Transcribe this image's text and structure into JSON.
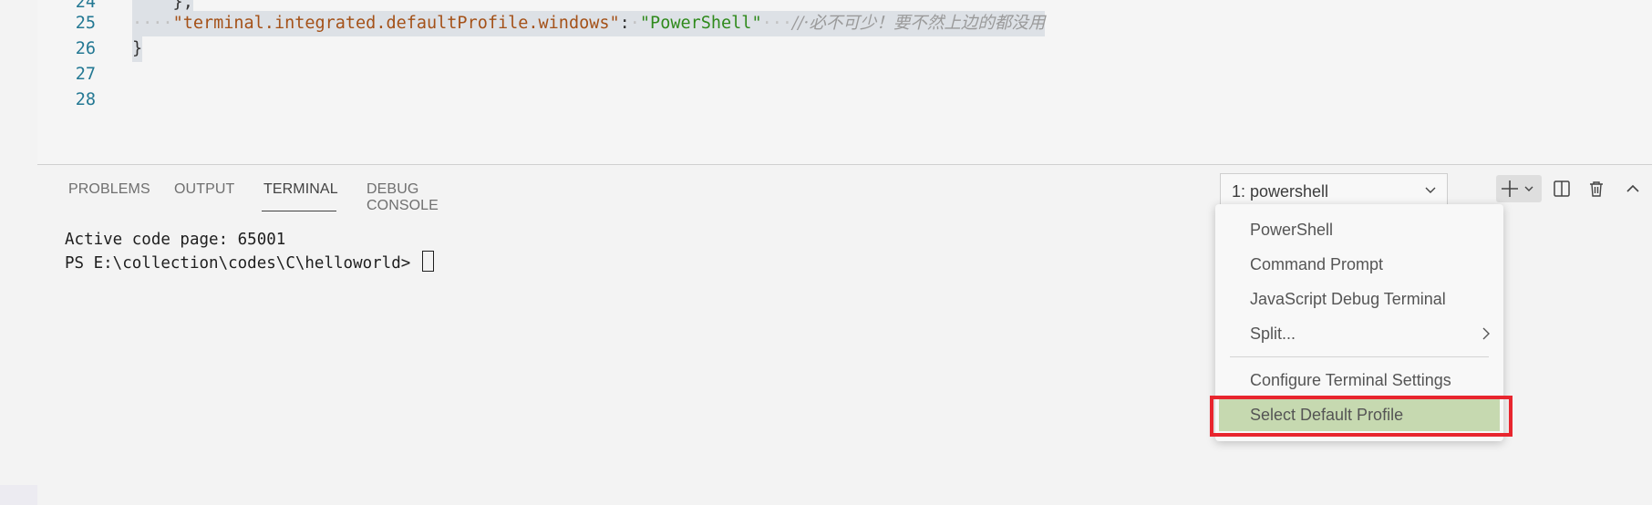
{
  "editor": {
    "lines": [
      {
        "num": "24",
        "text": "    },"
      },
      {
        "num": "25",
        "indent": "····",
        "key": "\"terminal.integrated.defaultProfile.windows\"",
        "colon": ":",
        "value": "\"PowerShell\"",
        "comment": "//·必不可少！要不然上边的都没用"
      },
      {
        "num": "26",
        "text": "}"
      },
      {
        "num": "27",
        "text": ""
      },
      {
        "num": "28",
        "text": ""
      }
    ]
  },
  "panel": {
    "tabs": [
      "PROBLEMS",
      "OUTPUT",
      "TERMINAL",
      "DEBUG CONSOLE"
    ],
    "active_tab": "TERMINAL",
    "terminal_lines": [
      "Active code page: 65001",
      "PS E:\\collection\\codes\\C\\helloworld> "
    ],
    "terminal_select": "1: powershell",
    "icons": {
      "new_terminal": "plus-icon",
      "launch_profile": "chevron-down-icon",
      "split": "split-icon",
      "kill": "trash-icon",
      "maximize": "chevron-up-icon",
      "close": "close-icon"
    }
  },
  "dropdown": {
    "items": [
      "PowerShell",
      "Command Prompt",
      "JavaScript Debug Terminal",
      "Split..."
    ],
    "items2": [
      "Configure Terminal Settings",
      "Select Default Profile"
    ],
    "highlighted": "Select Default Profile"
  },
  "colors": {
    "highlight_border": "#e8252e",
    "highlight_bg": "#c6d9b0"
  }
}
